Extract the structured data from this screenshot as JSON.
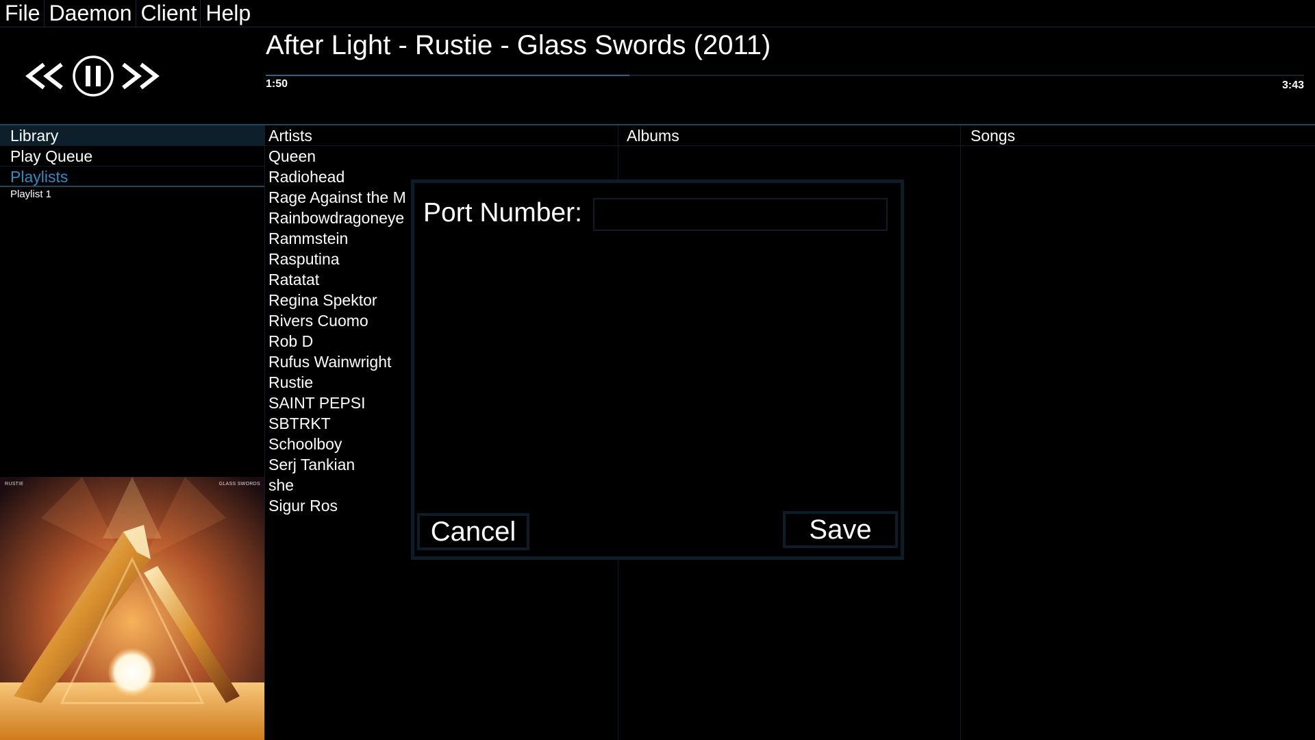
{
  "menu": [
    "File",
    "Daemon",
    "Client",
    "Help"
  ],
  "player": {
    "now_playing": "After Light - Rustie - Glass Swords (2011)",
    "elapsed": "1:50",
    "total": "3:43",
    "progress": 0.35
  },
  "sidebar": {
    "items": [
      "Library",
      "Play Queue",
      "Playlists"
    ],
    "playlists": [
      "Playlist 1"
    ]
  },
  "album_art": {
    "artist_text": "RUSTIE",
    "album_text": "GLASS SWORDS"
  },
  "columns": {
    "artists_header": "Artists",
    "albums_header": "Albums",
    "songs_header": "Songs"
  },
  "artists": [
    "Queen",
    "Radiohead",
    "Rage Against the M",
    "Rainbowdragoneye",
    "Rammstein",
    "Rasputina",
    "Ratatat",
    "Regina Spektor",
    "Rivers Cuomo",
    "Rob D",
    "Rufus Wainwright",
    "Rustie",
    "SAINT PEPSI",
    "SBTRKT",
    "Schoolboy",
    "Serj Tankian",
    "she",
    "Sigur Ros"
  ],
  "dialog": {
    "label": "Port Number:",
    "input_value": "",
    "cancel_label": "Cancel",
    "save_label": "Save"
  },
  "colors": {
    "accent": "#2d8dc4",
    "border": "#0b1e28",
    "background": "#000000"
  }
}
